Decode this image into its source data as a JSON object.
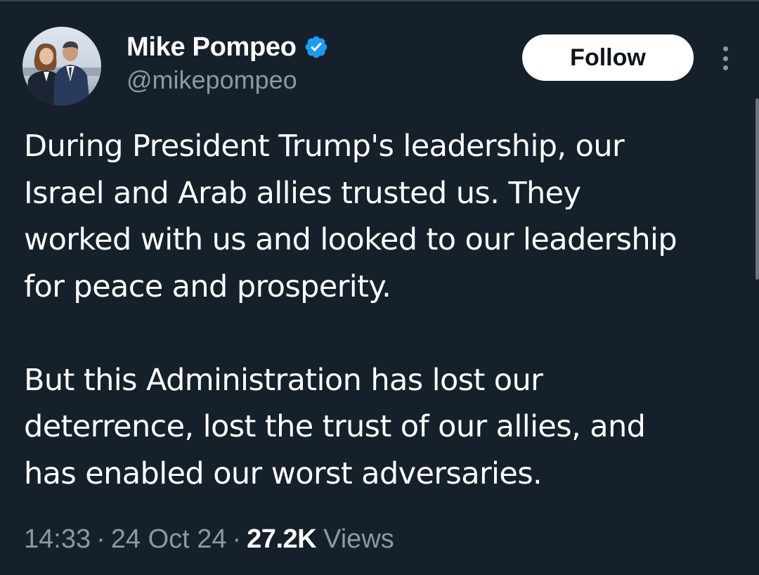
{
  "author": {
    "display_name": "Mike Pompeo",
    "handle": "@mikepompeo",
    "verified_icon": "verified-badge-icon",
    "avatar": "avatar-photo"
  },
  "actions": {
    "follow_label": "Follow",
    "more_icon": "more-options-icon"
  },
  "tweet": {
    "paragraph_1_lines": [
      "During President Trump's leadership, our",
      "Israel and Arab allies trusted us. They",
      "worked with us and looked to our leadership",
      "for peace and prosperity."
    ],
    "paragraph_2_lines": [
      "But this Administration has lost our",
      "deterrence, lost the trust of our allies, and",
      "has enabled our worst adversaries."
    ]
  },
  "meta": {
    "time": "14:33",
    "separator": "·",
    "date": "24 Oct 24",
    "views_count": "27.2K",
    "views_label": "Views"
  },
  "colors": {
    "background": "#15202b",
    "primary_text": "#ffffff",
    "secondary_text": "#8b98a5",
    "verified_blue": "#1d9bf0"
  }
}
